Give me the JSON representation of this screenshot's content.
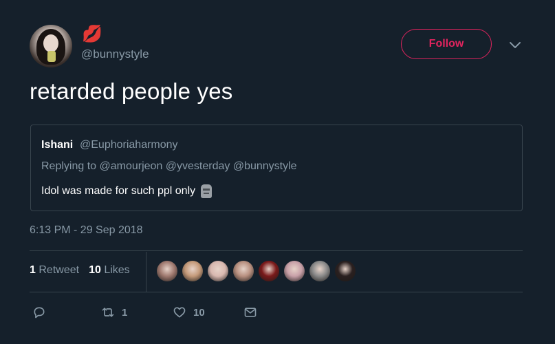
{
  "author": {
    "handle": "@bunnystyle",
    "name_emoji": "💋",
    "follow_label": "Follow"
  },
  "tweet": {
    "text": "retarded people yes",
    "timestamp": "6:13 PM - 29 Sep 2018"
  },
  "quoted": {
    "name": "Ishani",
    "handle": "@Euphoriaharmony",
    "replying_to": "Replying to @amourjeon @yvesterday @bunnystyle",
    "body": "Idol was made for such ppl only"
  },
  "stats": {
    "retweets_count": "1",
    "retweets_label": "Retweet",
    "likes_count": "10",
    "likes_label": "Likes"
  },
  "likers": [
    {
      "color": "#a07a70"
    },
    {
      "color": "#c49a7a"
    },
    {
      "color": "#d8b8b0"
    },
    {
      "color": "#b89080"
    },
    {
      "color": "#7a1a1a"
    },
    {
      "color": "#c8a0a8"
    },
    {
      "color": "#8a8a8a"
    },
    {
      "color": "#2a2020"
    }
  ],
  "actions": {
    "reply_count": "",
    "retweet_count": "1",
    "like_count": "10",
    "dm_count": ""
  },
  "colors": {
    "background": "#15202b",
    "accent": "#e0245e",
    "muted": "#8899a6",
    "border": "#38444d"
  }
}
